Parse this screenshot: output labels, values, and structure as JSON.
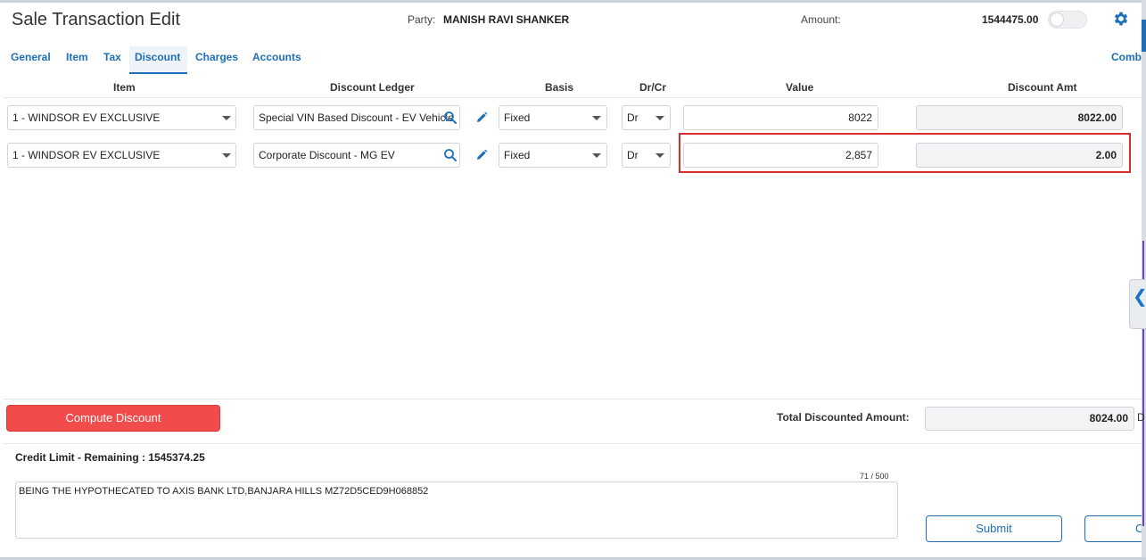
{
  "header": {
    "title": "Sale Transaction Edit",
    "party_label": "Party:",
    "party_value": "MANISH RAVI SHANKER",
    "amount_label": "Amount:",
    "amount_value": "1544475.00",
    "toggle_on": false
  },
  "tabs": [
    {
      "label": "General",
      "active": false
    },
    {
      "label": "Item",
      "active": false
    },
    {
      "label": "Tax",
      "active": false
    },
    {
      "label": "Discount",
      "active": true
    },
    {
      "label": "Charges",
      "active": false
    },
    {
      "label": "Accounts",
      "active": false
    },
    {
      "label": "Comb",
      "active": false
    }
  ],
  "columns": {
    "item": "Item",
    "ledger": "Discount Ledger",
    "basis": "Basis",
    "drcr": "Dr/Cr",
    "value": "Value",
    "discount_amt": "Discount Amt"
  },
  "rows": [
    {
      "item": "1 - WINDSOR EV EXCLUSIVE",
      "ledger": "Special VIN Based Discount - EV Vehicle",
      "basis": "Fixed",
      "drcr": "Dr",
      "value": "8022",
      "discount_amt": "8022.00"
    },
    {
      "item": "1 - WINDSOR EV EXCLUSIVE",
      "ledger": "Corporate Discount - MG EV",
      "basis": "Fixed",
      "drcr": "Dr",
      "value": "2,857",
      "discount_amt": "2.00"
    }
  ],
  "footer": {
    "compute_label": "Compute Discount",
    "total_label": "Total Discounted Amount:",
    "total_value": "8024.00",
    "total_suffix": "D",
    "credit_label": "Credit Limit - Remaining : 1545374.25",
    "char_count": "71 / 500",
    "narration": "BEING THE HYPOTHECATED TO AXIS BANK LTD,BANJARA HILLS MZ72D5CED9H068852",
    "submit_label": "Submit",
    "cancel_label": "C"
  },
  "colors": {
    "accent": "#1e6fb8",
    "compute": "#f24b4b",
    "highlight": "#d62d2d"
  },
  "icons": [
    "gear-icon",
    "search-icon",
    "pencil-icon",
    "chevron-down-icon",
    "chevron-left-icon"
  ]
}
